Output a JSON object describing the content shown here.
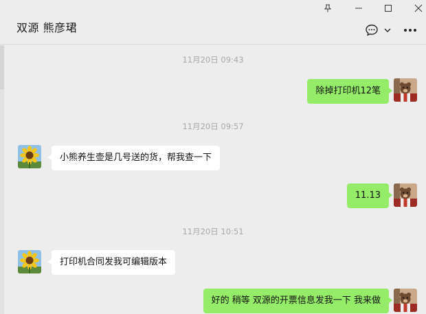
{
  "header": {
    "chat_title": "双源 熊彦珺",
    "icons": {
      "pin": "pin-icon",
      "minimize": "minimize-icon",
      "maximize": "maximize-icon",
      "close": "close-icon",
      "chat": "chat-bubble-icon",
      "chevron": "chevron-down-icon",
      "more": "more-icon"
    }
  },
  "messages": {
    "ts1": "11月20日 09:43",
    "m1": "除掉打印机12笔",
    "ts2": "11月20日 09:57",
    "m2": "小熊养生壶是几号送的货，帮我查一下",
    "m3": "11.13",
    "ts3": "11月20日 10:51",
    "m4": "打印机合同发我可编辑版本",
    "m5": "好的 稍等 双源的开票信息发我一下 我来做"
  },
  "colors": {
    "my_bubble": "#95ec69",
    "other_bubble": "#ffffff",
    "background": "#ededed",
    "timestamp": "#a9a9a9"
  }
}
